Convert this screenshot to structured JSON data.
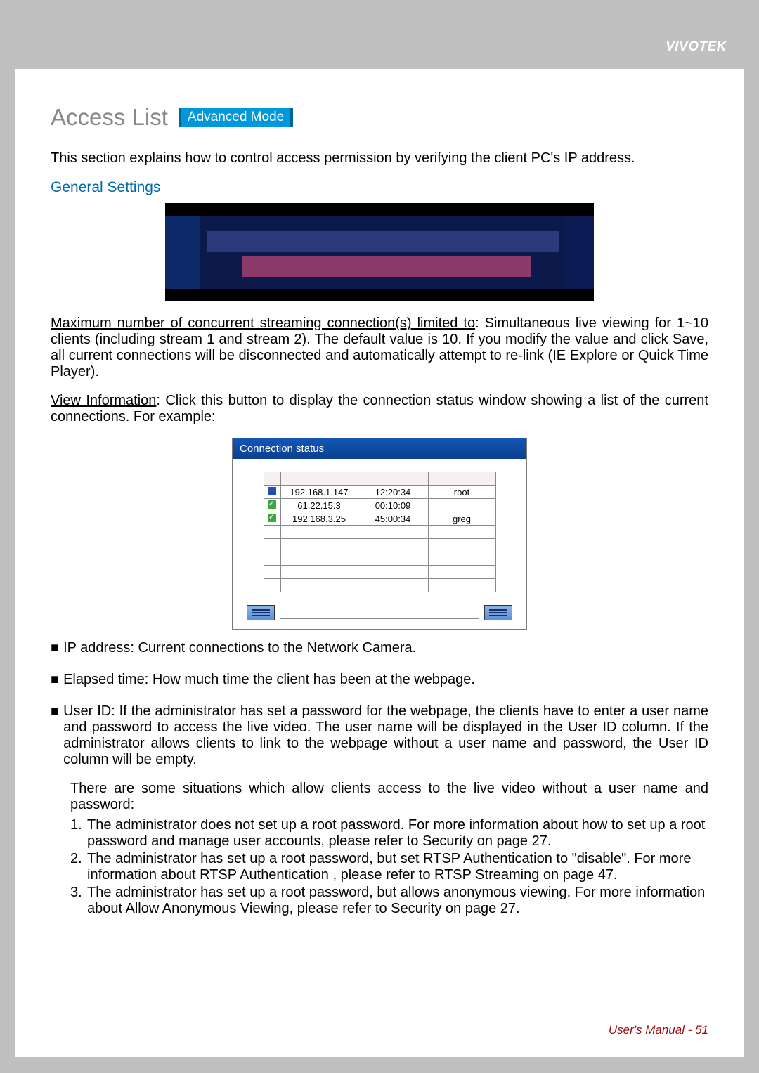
{
  "brand": "VIVOTEK",
  "title": "Access List",
  "mode_badge": "Advanced Mode",
  "intro": "This section explains how to control access permission by verifying the client PC's IP address.",
  "section_heading": "General Settings",
  "para1_label": "Maximum number of concurrent streaming connection(s) limited to",
  "para1_rest": ": Simultaneous live viewing for 1~10 clients (including stream 1 and stream 2). The default value is 10. If you modify the value and click Save, all current connections will be disconnected and automatically attempt to re-link (IE Explore or Quick Time Player).",
  "para2_label": "View Information",
  "para2_rest": ": Click this button to display the connection status window showing a list of the current connections. For example:",
  "conn_window": {
    "title": "Connection status",
    "headers": [
      "",
      "",
      "",
      ""
    ],
    "rows": [
      {
        "status": "blue",
        "ip": "192.168.1.147",
        "time": "12:20:34",
        "user": "root"
      },
      {
        "status": "green",
        "ip": "61.22.15.3",
        "time": "00:10:09",
        "user": ""
      },
      {
        "status": "green",
        "ip": "192.168.3.25",
        "time": "45:00:34",
        "user": "greg"
      },
      {
        "status": "",
        "ip": "",
        "time": "",
        "user": ""
      },
      {
        "status": "",
        "ip": "",
        "time": "",
        "user": ""
      },
      {
        "status": "",
        "ip": "",
        "time": "",
        "user": ""
      },
      {
        "status": "",
        "ip": "",
        "time": "",
        "user": ""
      },
      {
        "status": "",
        "ip": "",
        "time": "",
        "user": ""
      }
    ]
  },
  "bullets": [
    "IP address: Current connections to the Network Camera.",
    "Elapsed time: How much time the client has been at the webpage.",
    "User ID: If the administrator has set a password for the webpage, the clients have to enter a user name and password to access the live video. The user name will be displayed in the User ID column. If  the administrator allows clients to link to the webpage without a user name and password, the User ID column will be empty."
  ],
  "situations_intro": "There are some situations which allow clients access to the live video without a user name and password:",
  "situations": [
    "The administrator does not set up a root password. For more information about how to set up a root password and manage user accounts, please refer to Security on page 27.",
    "The administrator has set up a root password, but set RTSP Authentication to \"disable\". For more information about RTSP Authentication   , please refer to RTSP Streaming on page 47.",
    "The administrator has set up a root password, but allows anonymous viewing. For more information about Allow Anonymous Viewing,     please refer to Security on page 27."
  ],
  "footer": "User's Manual - 51"
}
